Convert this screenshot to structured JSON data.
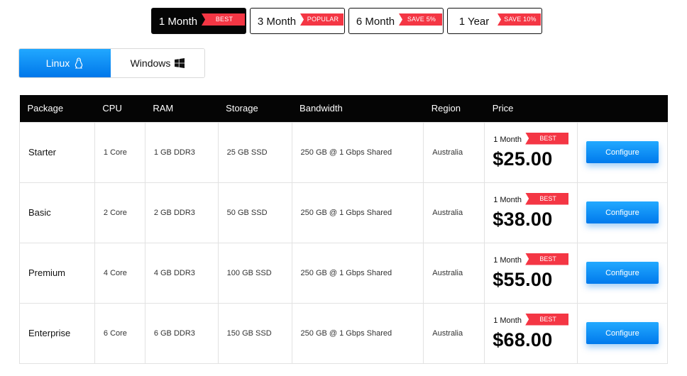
{
  "period_tabs": [
    {
      "label": "1 Month",
      "badge": "BEST",
      "active": true
    },
    {
      "label": "3 Month",
      "badge": "POPULAR",
      "active": false
    },
    {
      "label": "6 Month",
      "badge": "SAVE 5%",
      "active": false
    },
    {
      "label": "1 Year",
      "badge": "SAVE 10%",
      "active": false
    }
  ],
  "os_tabs": [
    {
      "label": "Linux",
      "icon": "linux-penguin-icon",
      "active": true
    },
    {
      "label": "Windows",
      "icon": "windows-logo-icon",
      "active": false
    }
  ],
  "colors": {
    "accent": "#0a8cf7",
    "badge": "#f43644",
    "header": "#050505"
  },
  "table": {
    "headers": [
      "Package",
      "CPU",
      "RAM",
      "Storage",
      "Bandwidth",
      "Region",
      "Price",
      ""
    ],
    "rows": [
      {
        "package": "Starter",
        "cpu": "1 Core",
        "ram": "1 GB DDR3",
        "storage": "25 GB SSD",
        "bandwidth": "250 GB @ 1 Gbps Shared",
        "region": "Australia",
        "period": "1 Month",
        "badge": "BEST",
        "price": "$25.00",
        "action": "Configure"
      },
      {
        "package": "Basic",
        "cpu": "2 Core",
        "ram": "2 GB DDR3",
        "storage": "50 GB SSD",
        "bandwidth": "250 GB @ 1 Gbps Shared",
        "region": "Australia",
        "period": "1 Month",
        "badge": "BEST",
        "price": "$38.00",
        "action": "Configure"
      },
      {
        "package": "Premium",
        "cpu": "4 Core",
        "ram": "4 GB DDR3",
        "storage": "100 GB SSD",
        "bandwidth": "250 GB @ 1 Gbps Shared",
        "region": "Australia",
        "period": "1 Month",
        "badge": "BEST",
        "price": "$55.00",
        "action": "Configure"
      },
      {
        "package": "Enterprise",
        "cpu": "6 Core",
        "ram": "6 GB DDR3",
        "storage": "150 GB SSD",
        "bandwidth": "250 GB @ 1 Gbps Shared",
        "region": "Australia",
        "period": "1 Month",
        "badge": "BEST",
        "price": "$68.00",
        "action": "Configure"
      }
    ]
  }
}
